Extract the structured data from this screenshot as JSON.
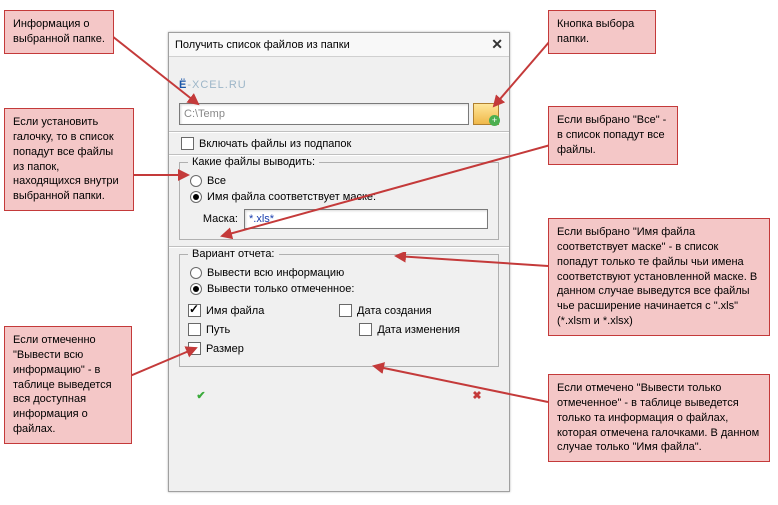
{
  "window": {
    "title": "Получить список файлов из папки",
    "logo_prefix": "Ё",
    "logo_rest": "-XCEL.RU",
    "path_value": "C:\\Temp",
    "include_subfolders": "Включать файлы из подпапок"
  },
  "filter": {
    "legend": "Какие файлы выводить:",
    "all": "Все",
    "by_mask": "Имя файла соответствует маске:",
    "mask_label": "Маска:",
    "mask_value": "*.xls*"
  },
  "report": {
    "legend": "Вариант отчета:",
    "full": "Вывести всю информацию",
    "selected": "Вывести только отмеченное:",
    "cb_filename": "Имя файла",
    "cb_path": "Путь",
    "cb_size": "Размер",
    "cb_created": "Дата создания",
    "cb_modified": "Дата изменения"
  },
  "callouts": {
    "c1": "Информация о выбранной папке.",
    "c2": "Если установить галочку, то в список попадут все файлы из папок, находящихся внутри выбранной папки.",
    "c3": "Если отмеченно \"Вывести всю информацию\" - в таблице выведется вся доступная информация о файлах.",
    "c4": "Кнопка выбора папки.",
    "c5": "Если выбрано \"Все\" - в список попадут все файлы.",
    "c6": "Если выбрано \"Имя файла соответствует маске\" - в список попадут только те файлы чьи имена соответствуют установленной маске. В данном случае выведутся все файлы чье расширение начинается с \".xls\" (*.xlsm и *.xlsx)",
    "c7": "Если отмечено \"Вывести только отмеченное\" - в таблице выведется только та информация о файлах, которая отмечена галочками. В данном случае только \"Имя файла\"."
  }
}
